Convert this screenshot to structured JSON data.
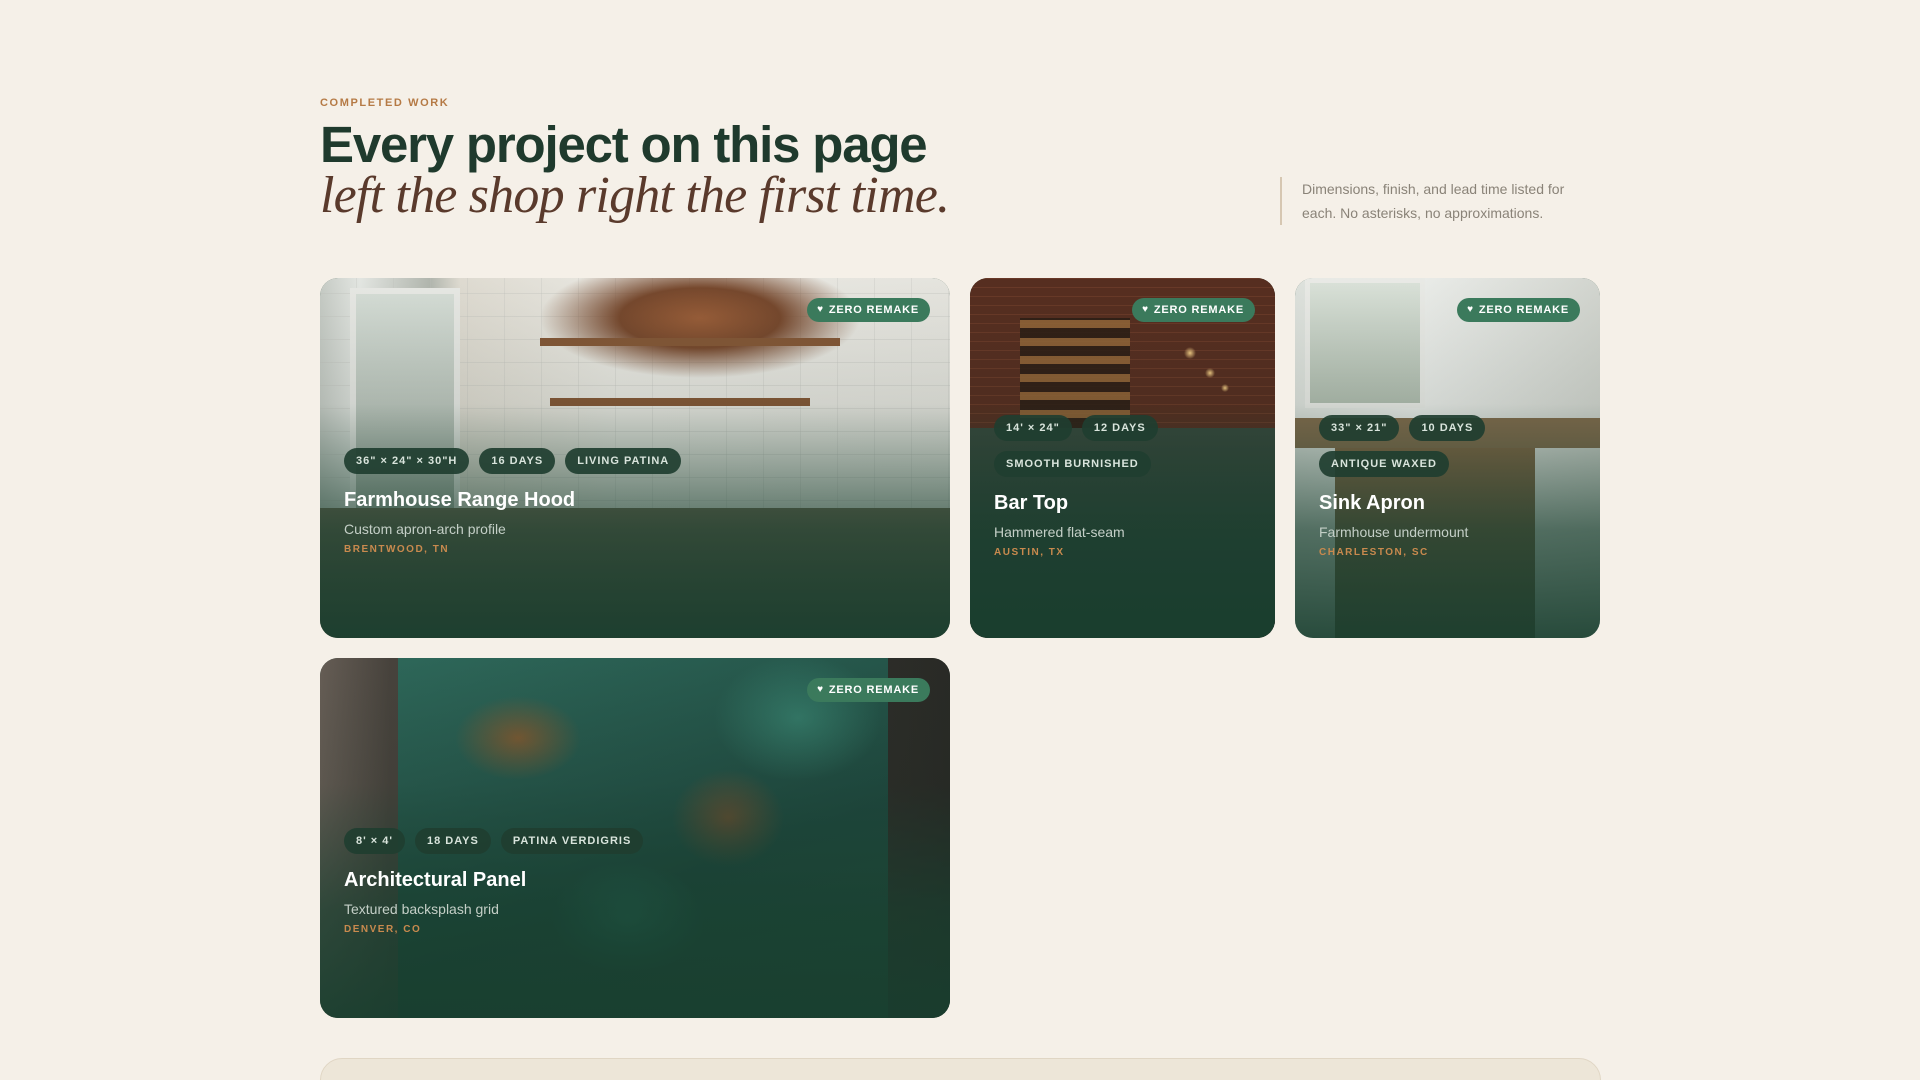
{
  "header": {
    "eyebrow": "COMPLETED WORK",
    "headline": "Every project on this page",
    "subheadline": "left the shop right the first time.",
    "side_note": "Dimensions, finish, and lead time listed for each. No asterisks, no approximations."
  },
  "projects": [
    {
      "badge": "ZERO REMAKE",
      "chips": [
        "36\" × 24\" × 30\"H",
        "16 DAYS",
        "LIVING PATINA"
      ],
      "title": "Farmhouse Range Hood",
      "description": "Custom apron-arch profile",
      "location": "BRENTWOOD, TN"
    },
    {
      "badge": "ZERO REMAKE",
      "chips": [
        "14' × 24\"",
        "12 DAYS",
        "SMOOTH BURNISHED"
      ],
      "title": "Bar Top",
      "description": "Hammered flat-seam",
      "location": "AUSTIN, TX"
    },
    {
      "badge": "ZERO REMAKE",
      "chips": [
        "33\" × 21\"",
        "10 DAYS",
        "ANTIQUE WAXED"
      ],
      "title": "Sink Apron",
      "description": "Farmhouse undermount",
      "location": "CHARLESTON, SC"
    },
    {
      "badge": "ZERO REMAKE",
      "chips": [
        "8' × 4'",
        "18 DAYS",
        "PATINA VERDIGRIS"
      ],
      "title": "Architectural Panel",
      "description": "Textured backsplash grid",
      "location": "DENVER, CO"
    }
  ]
}
